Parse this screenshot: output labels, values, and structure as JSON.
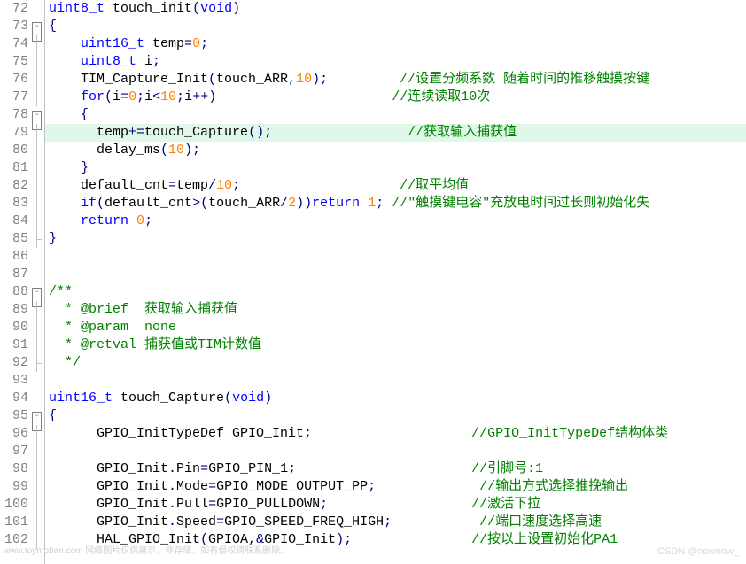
{
  "editor": {
    "lines": [
      {
        "n": 72,
        "fold": "",
        "seg": [
          [
            "kw",
            "uint8_t"
          ],
          [
            "p",
            " touch_init"
          ],
          [
            "op",
            "("
          ],
          [
            "kw",
            "void"
          ],
          [
            "op",
            ")"
          ]
        ]
      },
      {
        "n": 73,
        "fold": "box",
        "seg": [
          [
            "op",
            "{"
          ]
        ]
      },
      {
        "n": 74,
        "fold": "line",
        "seg": [
          [
            "p",
            "    "
          ],
          [
            "kw",
            "uint16_t"
          ],
          [
            "p",
            " temp"
          ],
          [
            "op",
            "="
          ],
          [
            "num",
            "0"
          ],
          [
            "op",
            ";"
          ]
        ]
      },
      {
        "n": 75,
        "fold": "line",
        "seg": [
          [
            "p",
            "    "
          ],
          [
            "kw",
            "uint8_t"
          ],
          [
            "p",
            " i"
          ],
          [
            "op",
            ";"
          ]
        ]
      },
      {
        "n": 76,
        "fold": "line",
        "seg": [
          [
            "p",
            "    TIM_Capture_Init"
          ],
          [
            "op",
            "("
          ],
          [
            "p",
            "touch_ARR"
          ],
          [
            "op",
            ","
          ],
          [
            "num",
            "10"
          ],
          [
            "op",
            ")"
          ],
          [
            "op",
            ";"
          ],
          [
            "p",
            "         "
          ],
          [
            "cmt",
            "//设置分频系数 随着时间的推移触摸按键"
          ]
        ]
      },
      {
        "n": 77,
        "fold": "line",
        "seg": [
          [
            "p",
            "    "
          ],
          [
            "kw",
            "for"
          ],
          [
            "op",
            "("
          ],
          [
            "p",
            "i"
          ],
          [
            "op",
            "="
          ],
          [
            "num",
            "0"
          ],
          [
            "op",
            ";"
          ],
          [
            "p",
            "i"
          ],
          [
            "op",
            "<"
          ],
          [
            "num",
            "10"
          ],
          [
            "op",
            ";"
          ],
          [
            "p",
            "i"
          ],
          [
            "op",
            "++"
          ],
          [
            "op",
            ")"
          ],
          [
            "p",
            "                      "
          ],
          [
            "cmt",
            "//连续读取10次"
          ]
        ]
      },
      {
        "n": 78,
        "fold": "box",
        "seg": [
          [
            "p",
            "    "
          ],
          [
            "op",
            "{"
          ]
        ]
      },
      {
        "n": 79,
        "fold": "line",
        "hl": true,
        "seg": [
          [
            "p",
            "      temp"
          ],
          [
            "op",
            "+="
          ],
          [
            "p",
            "touch_Capture"
          ],
          [
            "op",
            "()"
          ],
          [
            "op",
            ";"
          ],
          [
            "p",
            "                 "
          ],
          [
            "cmt",
            "//获取输入捕获值"
          ]
        ]
      },
      {
        "n": 80,
        "fold": "line",
        "seg": [
          [
            "p",
            "      delay_ms"
          ],
          [
            "op",
            "("
          ],
          [
            "num",
            "10"
          ],
          [
            "op",
            ")"
          ],
          [
            "op",
            ";"
          ]
        ]
      },
      {
        "n": 81,
        "fold": "line",
        "seg": [
          [
            "p",
            "    "
          ],
          [
            "op",
            "}"
          ]
        ]
      },
      {
        "n": 82,
        "fold": "line",
        "seg": [
          [
            "p",
            "    default_cnt"
          ],
          [
            "op",
            "="
          ],
          [
            "p",
            "temp"
          ],
          [
            "op",
            "/"
          ],
          [
            "num",
            "10"
          ],
          [
            "op",
            ";"
          ],
          [
            "p",
            "                    "
          ],
          [
            "cmt",
            "//取平均值"
          ]
        ]
      },
      {
        "n": 83,
        "fold": "line",
        "seg": [
          [
            "p",
            "    "
          ],
          [
            "kw",
            "if"
          ],
          [
            "op",
            "("
          ],
          [
            "p",
            "default_cnt"
          ],
          [
            "op",
            ">("
          ],
          [
            "p",
            "touch_ARR"
          ],
          [
            "op",
            "/"
          ],
          [
            "num",
            "2"
          ],
          [
            "op",
            "))"
          ],
          [
            "kw",
            "return"
          ],
          [
            "p",
            " "
          ],
          [
            "num",
            "1"
          ],
          [
            "op",
            ";"
          ],
          [
            "p",
            " "
          ],
          [
            "cmt",
            "//\"触摸键电容\"充放电时间过长则初始化失"
          ]
        ]
      },
      {
        "n": 84,
        "fold": "line",
        "seg": [
          [
            "p",
            "    "
          ],
          [
            "kw",
            "return"
          ],
          [
            "p",
            " "
          ],
          [
            "num",
            "0"
          ],
          [
            "op",
            ";"
          ]
        ]
      },
      {
        "n": 85,
        "fold": "end",
        "seg": [
          [
            "op",
            "}"
          ]
        ]
      },
      {
        "n": 86,
        "fold": "",
        "seg": [
          [
            "p",
            ""
          ]
        ]
      },
      {
        "n": 87,
        "fold": "",
        "seg": [
          [
            "p",
            ""
          ]
        ]
      },
      {
        "n": 88,
        "fold": "box",
        "seg": [
          [
            "cmt",
            "/**"
          ]
        ]
      },
      {
        "n": 89,
        "fold": "line",
        "seg": [
          [
            "cmt",
            "  * @brief  获取输入捕获值"
          ]
        ]
      },
      {
        "n": 90,
        "fold": "line",
        "seg": [
          [
            "cmt",
            "  * @param  none"
          ]
        ]
      },
      {
        "n": 91,
        "fold": "line",
        "seg": [
          [
            "cmt",
            "  * @retval 捕获值或TIM计数值"
          ]
        ]
      },
      {
        "n": 92,
        "fold": "end",
        "seg": [
          [
            "cmt",
            "  */"
          ]
        ]
      },
      {
        "n": 93,
        "fold": "",
        "seg": [
          [
            "p",
            ""
          ]
        ]
      },
      {
        "n": 94,
        "fold": "",
        "seg": [
          [
            "kw",
            "uint16_t"
          ],
          [
            "p",
            " touch_Capture"
          ],
          [
            "op",
            "("
          ],
          [
            "kw",
            "void"
          ],
          [
            "op",
            ")"
          ]
        ]
      },
      {
        "n": 95,
        "fold": "box",
        "seg": [
          [
            "op",
            "{"
          ]
        ]
      },
      {
        "n": 96,
        "fold": "line",
        "seg": [
          [
            "p",
            "      GPIO_InitTypeDef GPIO_Init"
          ],
          [
            "op",
            ";"
          ],
          [
            "p",
            "                    "
          ],
          [
            "cmt",
            "//GPIO_InitTypeDef结构体类"
          ]
        ]
      },
      {
        "n": 97,
        "fold": "line",
        "seg": [
          [
            "p",
            ""
          ]
        ]
      },
      {
        "n": 98,
        "fold": "line",
        "seg": [
          [
            "p",
            "      GPIO_Init"
          ],
          [
            "op",
            "."
          ],
          [
            "p",
            "Pin"
          ],
          [
            "op",
            "="
          ],
          [
            "p",
            "GPIO_PIN_1"
          ],
          [
            "op",
            ";"
          ],
          [
            "p",
            "                      "
          ],
          [
            "cmt",
            "//引脚号:1"
          ]
        ]
      },
      {
        "n": 99,
        "fold": "line",
        "seg": [
          [
            "p",
            "      GPIO_Init"
          ],
          [
            "op",
            "."
          ],
          [
            "p",
            "Mode"
          ],
          [
            "op",
            "="
          ],
          [
            "p",
            "GPIO_MODE_OUTPUT_PP"
          ],
          [
            "op",
            ";"
          ],
          [
            "p",
            "             "
          ],
          [
            "cmt",
            "//输出方式选择推挽输出"
          ]
        ]
      },
      {
        "n": 100,
        "fold": "line",
        "seg": [
          [
            "p",
            "      GPIO_Init"
          ],
          [
            "op",
            "."
          ],
          [
            "p",
            "Pull"
          ],
          [
            "op",
            "="
          ],
          [
            "p",
            "GPIO_PULLDOWN"
          ],
          [
            "op",
            ";"
          ],
          [
            "p",
            "                  "
          ],
          [
            "cmt",
            "//激活下拉"
          ]
        ]
      },
      {
        "n": 101,
        "fold": "line",
        "seg": [
          [
            "p",
            "      GPIO_Init"
          ],
          [
            "op",
            "."
          ],
          [
            "p",
            "Speed"
          ],
          [
            "op",
            "="
          ],
          [
            "p",
            "GPIO_SPEED_FREQ_HIGH"
          ],
          [
            "op",
            ";"
          ],
          [
            "p",
            "           "
          ],
          [
            "cmt",
            "//端口速度选择高速"
          ]
        ]
      },
      {
        "n": 102,
        "fold": "line",
        "seg": [
          [
            "p",
            "      HAL_GPIO_Init"
          ],
          [
            "op",
            "("
          ],
          [
            "p",
            "GPIOA"
          ],
          [
            "op",
            ",&"
          ],
          [
            "p",
            "GPIO_Init"
          ],
          [
            "op",
            ")"
          ],
          [
            "op",
            ";"
          ],
          [
            "p",
            "               "
          ],
          [
            "cmt",
            "//按以上设置初始化PA1"
          ]
        ]
      }
    ]
  },
  "watermarks": {
    "left": "www.toymoban.com 网络图片仅供展示，非存储，如有侵权请联系删除。",
    "right": "CSDN @nownow_"
  }
}
